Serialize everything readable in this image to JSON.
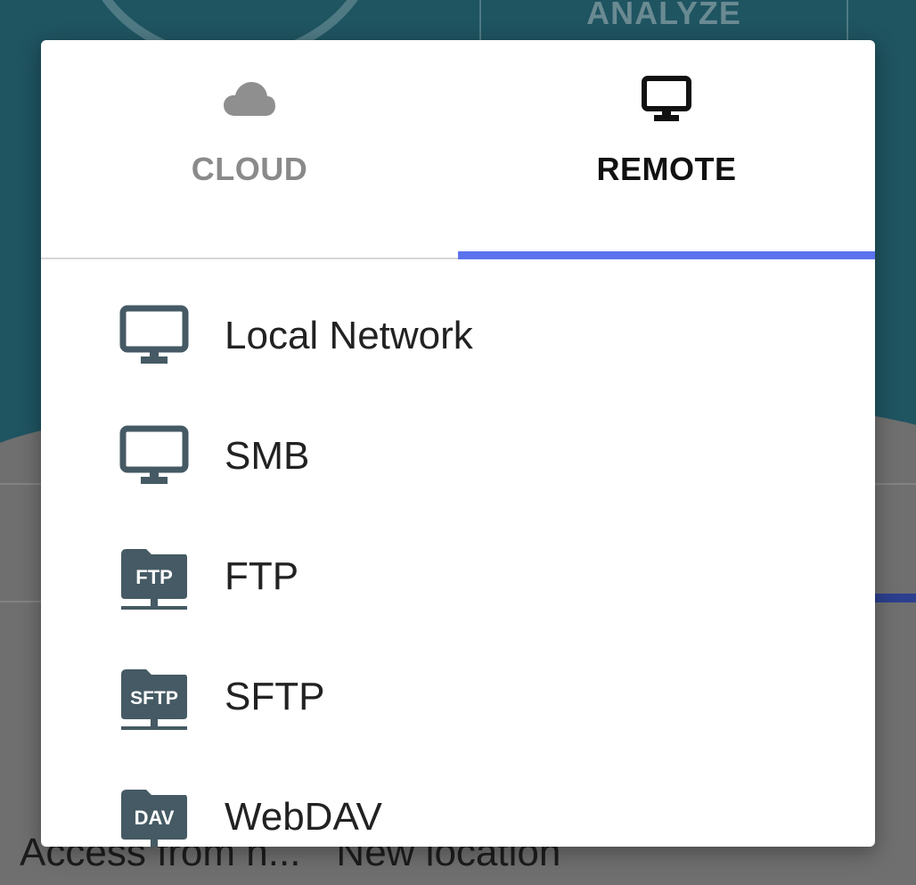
{
  "background": {
    "analyze_label": "ANALYZE",
    "bottom_left_label": "Access from n...",
    "bottom_right_label": "New location"
  },
  "dialog": {
    "tabs": [
      {
        "label": "CLOUD",
        "icon": "cloud-icon",
        "selected": false
      },
      {
        "label": "REMOTE",
        "icon": "monitor-icon",
        "selected": true
      }
    ],
    "items": [
      {
        "label": "Local Network",
        "icon": "monitor-icon"
      },
      {
        "label": "SMB",
        "icon": "monitor-icon"
      },
      {
        "label": "FTP",
        "icon": "ftp-server-icon",
        "icon_text": "FTP"
      },
      {
        "label": "SFTP",
        "icon": "sftp-server-icon",
        "icon_text": "SFTP"
      },
      {
        "label": "WebDAV",
        "icon": "webdav-server-icon",
        "icon_text": "DAV"
      }
    ]
  },
  "colors": {
    "tab_indicator": "#5b72ee",
    "icon_slate": "#455a64",
    "background_teal": "#1f5461"
  }
}
